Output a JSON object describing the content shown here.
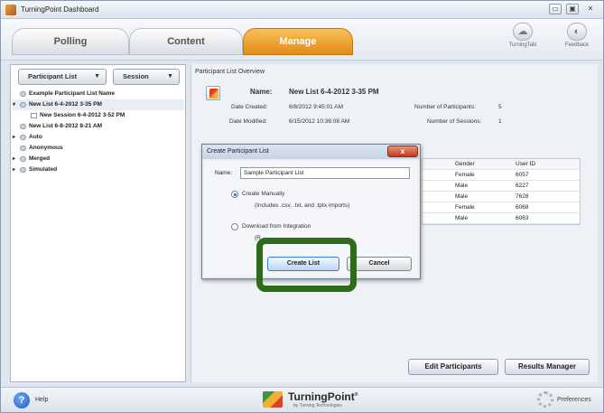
{
  "window": {
    "title": "TurningPoint Dashboard",
    "controls": [
      "▭",
      "▣",
      "✕"
    ]
  },
  "tabs": [
    "Polling",
    "Content",
    "Manage"
  ],
  "top_icons": [
    {
      "icon": "turningtalk-icon",
      "label": "TurningTalk"
    },
    {
      "icon": "feedback-icon",
      "label": "Feedback"
    }
  ],
  "sidebar": {
    "participant_list_dropdown": "Participant List",
    "session_dropdown": "Session",
    "tree": [
      {
        "label": "Example Participant List Name",
        "expander": "",
        "indent": 0
      },
      {
        "label": "New List 6-4-2012 3-35 PM",
        "expander": "▾",
        "indent": 0
      },
      {
        "label": "New Session 6-4-2012 3-52 PM",
        "expander": "",
        "indent": 1
      },
      {
        "label": "New List 6-8-2012 8-21 AM",
        "expander": "",
        "indent": 0
      },
      {
        "label": "Auto",
        "expander": "▸",
        "indent": 0
      },
      {
        "label": "Anonymous",
        "expander": "",
        "indent": 0
      },
      {
        "label": "Merged",
        "expander": "▸",
        "indent": 0
      },
      {
        "label": "Simulated",
        "expander": "▸",
        "indent": 0
      }
    ]
  },
  "overview": {
    "section_title": "Participant List Overview",
    "name_label": "Name:",
    "name_value": "New List 6-4-2012 3-35 PM",
    "date_created_label": "Date Created:",
    "date_created_value": "6/8/2012 9:45:01 AM",
    "date_modified_label": "Date Modified:",
    "date_modified_value": "6/15/2012 10:36:08 AM",
    "participants_label": "Number of Participants:",
    "participants_value": "5",
    "sessions_label": "Number of Sessions:",
    "sessions_value": "1"
  },
  "grid": {
    "columns": [
      "Gender",
      "User ID"
    ],
    "rows": [
      [
        "Female",
        "6057"
      ],
      [
        "Male",
        "6227"
      ],
      [
        "Male",
        "7628"
      ],
      [
        "Female",
        "6068"
      ],
      [
        "Male",
        "6063"
      ]
    ]
  },
  "buttons": {
    "edit_participants": "Edit Participants",
    "results_manager": "Results Manager"
  },
  "dialog": {
    "title": "Create Participant List",
    "close": "x",
    "name_label": "Name:",
    "name_value": "Sample Participant List",
    "option1": "Create Manually",
    "option1_note": "(Includes .csv, .txt, and .tptx imports)",
    "option2": "Download from Integration",
    "option2_note": "(R...",
    "create_button": "Create List",
    "cancel_button": "Cancel"
  },
  "footer": {
    "help": "Help",
    "brand": "TurningPoint",
    "brand_mark": "®",
    "brand_sub": "by Turning Technologies",
    "preferences": "Preferences"
  }
}
